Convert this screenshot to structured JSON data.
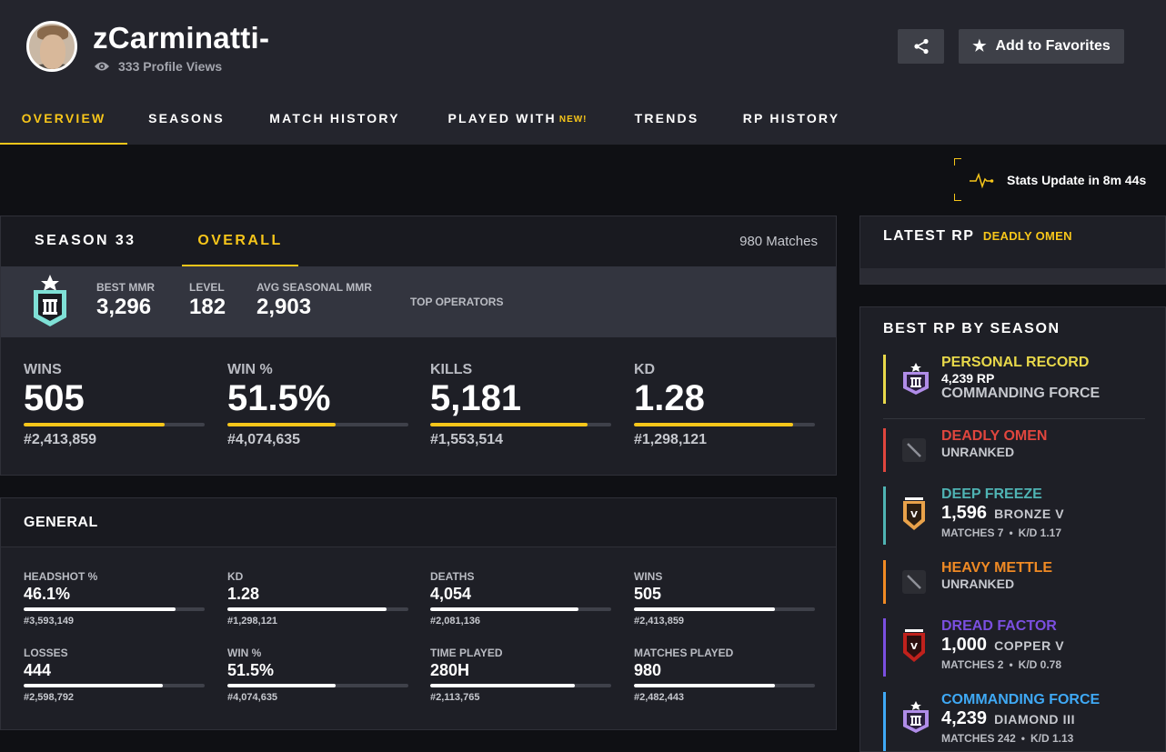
{
  "profile": {
    "name": "zCarminatti-",
    "views": "333 Profile Views"
  },
  "header": {
    "favorites_label": "Add to Favorites"
  },
  "nav": {
    "tabs": [
      {
        "label": "OVERVIEW",
        "active": true
      },
      {
        "label": "SEASONS",
        "active": false
      },
      {
        "label": "MATCH HISTORY",
        "active": false
      },
      {
        "label": "PLAYED WITH",
        "badge": "NEW!",
        "active": false
      },
      {
        "label": "TRENDS",
        "active": false
      },
      {
        "label": "RP HISTORY",
        "active": false
      }
    ]
  },
  "stats_update": "Stats Update in 8m 44s",
  "season_panel": {
    "tabs": [
      "SEASON 33",
      "OVERALL"
    ],
    "active_tab": "OVERALL",
    "matches": "980 Matches",
    "rank_stats": [
      {
        "label": "BEST MMR",
        "value": "3,296"
      },
      {
        "label": "LEVEL",
        "value": "182"
      },
      {
        "label": "AVG SEASONAL MMR",
        "value": "2,903"
      }
    ],
    "top_operators_label": "TOP OPERATORS",
    "big_stats": [
      {
        "label": "WINS",
        "value": "505",
        "rank": "#2,413,859",
        "percentile": 0.78
      },
      {
        "label": "WIN %",
        "value": "51.5%",
        "rank": "#4,074,635",
        "percentile": 0.6
      },
      {
        "label": "KILLS",
        "value": "5,181",
        "rank": "#1,553,514",
        "percentile": 0.87
      },
      {
        "label": "KD",
        "value": "1.28",
        "rank": "#1,298,121",
        "percentile": 0.88
      }
    ]
  },
  "general": {
    "title": "GENERAL",
    "stats": [
      {
        "label": "HEADSHOT %",
        "value": "46.1%",
        "rank": "#3,593,149",
        "percentile": 0.84
      },
      {
        "label": "KD",
        "value": "1.28",
        "rank": "#1,298,121",
        "percentile": 0.88
      },
      {
        "label": "DEATHS",
        "value": "4,054",
        "rank": "#2,081,136",
        "percentile": 0.82
      },
      {
        "label": "WINS",
        "value": "505",
        "rank": "#2,413,859",
        "percentile": 0.78
      },
      {
        "label": "LOSSES",
        "value": "444",
        "rank": "#2,598,792",
        "percentile": 0.77
      },
      {
        "label": "WIN %",
        "value": "51.5%",
        "rank": "#4,074,635",
        "percentile": 0.6
      },
      {
        "label": "TIME PLAYED",
        "value": "280H",
        "rank": "#2,113,765",
        "percentile": 0.8
      },
      {
        "label": "MATCHES PLAYED",
        "value": "980",
        "rank": "#2,482,443",
        "percentile": 0.78
      }
    ]
  },
  "latest_rp": {
    "title": "LATEST RP",
    "season": "DEADLY OMEN"
  },
  "best_rp": {
    "title": "BEST RP BY SEASON",
    "personal_record": {
      "label": "PERSONAL RECORD",
      "rp": "4,239 RP",
      "season": "COMMANDING FORCE",
      "color": "#e8d84a"
    },
    "seasons": [
      {
        "name": "DEADLY OMEN",
        "status": "UNRANKED",
        "color": "#e0463e",
        "icon": "unranked-icon"
      },
      {
        "name": "DEEP FREEZE",
        "rp": "1,596",
        "tier": "BRONZE V",
        "matches": "MATCHES 7",
        "kd": "K/D 1.17",
        "dot": "•",
        "color": "#4fb3b3",
        "icon": "bronze-rank-icon"
      },
      {
        "name": "HEAVY METTLE",
        "status": "UNRANKED",
        "color": "#f08a24",
        "icon": "unranked-icon"
      },
      {
        "name": "DREAD FACTOR",
        "rp": "1,000",
        "tier": "COPPER V",
        "matches": "MATCHES 2",
        "kd": "K/D 0.78",
        "dot": "•",
        "color": "#7b4fe0",
        "icon": "copper-rank-icon"
      },
      {
        "name": "COMMANDING FORCE",
        "rp": "4,239",
        "tier": "DIAMOND III",
        "matches": "MATCHES 242",
        "kd": "K/D 1.13",
        "dot": "•",
        "color": "#3fa9f5",
        "icon": "diamond-rank-icon"
      }
    ]
  },
  "colors": {
    "accent": "#f7c61a",
    "panel": "#1e1f26",
    "header": "#24252d"
  }
}
